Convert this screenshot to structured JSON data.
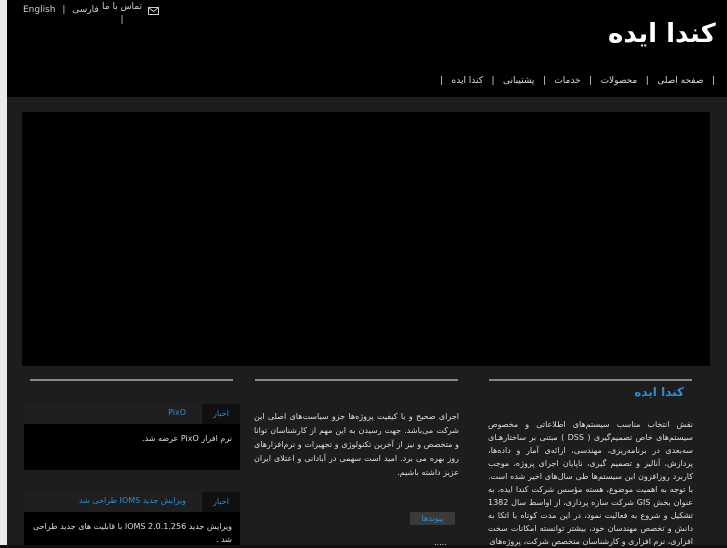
{
  "header": {
    "lang_english": "English",
    "lang_sep": "|",
    "lang_farsi": "فارسی",
    "contact_label": "تماس با ما",
    "contact_sep": "|",
    "logo": "کندا ایده"
  },
  "nav": {
    "items": [
      "صفحه اصلی",
      "محصولات",
      "خدمات",
      "پشتیبانی",
      "کندا ایده"
    ],
    "sep": "|"
  },
  "about": {
    "title": "کندا ایده",
    "text": "نقش‌ انتخاب‌ مناسب سیستم‌های اطلاعاتی و مخصوص سیستم‌های خاص تصمیم‌گیری ( DSS ) مبتنی بر ساختارهـای سه‌بعدی در برنامه‌ریزی، مهندسی، ارائه‌ی آمار و داده‌ها، پردازش، آنالیز و تصمیم گیری، ناپایان اجرای پروژه، موجب کاربرد روزافزون این سیستم‌ها طی سال‌های اخیر شده است. با توجه به اهمیت موضوع، هسته مؤسس شرکت کندا ایده، به عنوان بخش GIS شرکت سازه پردازی، از اواسط سال 1382 تشکیل و شروع به فعالیت نمود، در این مدت کوتاه با اتکا به دانش و تخصص مهندسان خود، بیشتر توانسته امکانات سخت افزاری، نرم افزاری و کارشناسان متخصص شرکت، پروژه‌های"
  },
  "middle": {
    "text": "اجرای صحیح و با کیفیت پروژه‌ها جزو سیاست‌های اصلی این شرکت می‌باشد. جهت رسیدن به این مهم از کارشناسان توانا و متخصص و نیز از آخرین تکنولوژی و تجهیزات و نرم‌افزارهای روز بهره می برد. امید است سهمی در آبادانی و اعتلای ایران عزیز داشته باشیم.",
    "links_label": "پیوندها",
    "links_extra": "....."
  },
  "news": [
    {
      "tag": "اخبار",
      "title": "PixO",
      "body": "نرم افزار PixO عرضه شد."
    },
    {
      "tag": "اخبار",
      "title": "ویرایش جدید IOMS طراحی شد",
      "body": "ویرایش جدید IOMS 2.0.1.256 با قابلیت های جدید طراحی شد ."
    }
  ]
}
